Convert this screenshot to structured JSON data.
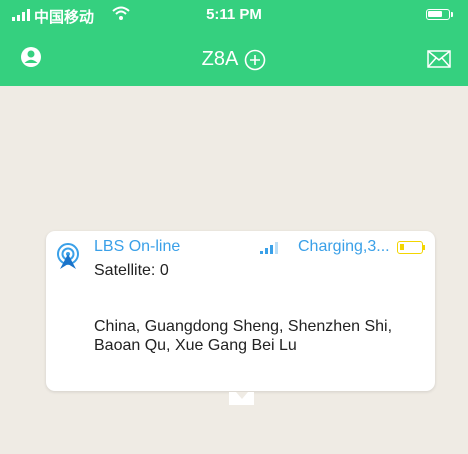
{
  "status_bar": {
    "carrier": "中国移动",
    "time": "5:11 PM"
  },
  "nav": {
    "title": "Z8A"
  },
  "icons": {
    "profile": "profile-icon",
    "add": "add-circle-icon",
    "mail": "mail-icon",
    "lbs": "location-antenna-icon",
    "signal": "signal-strength-icon",
    "battery": "battery-icon"
  },
  "info_card": {
    "status": "LBS On-line",
    "charging": "Charging,3...",
    "satellite": "Satellite: 0",
    "address": "China, Guangdong Sheng, Shenzhen Shi, Baoan Qu, Xue Gang Bei Lu"
  },
  "colors": {
    "header": "#35d07f",
    "accent_blue": "#3aa0e8",
    "battery_yellow": "#f3d500",
    "map_bg": "#efebe4"
  }
}
